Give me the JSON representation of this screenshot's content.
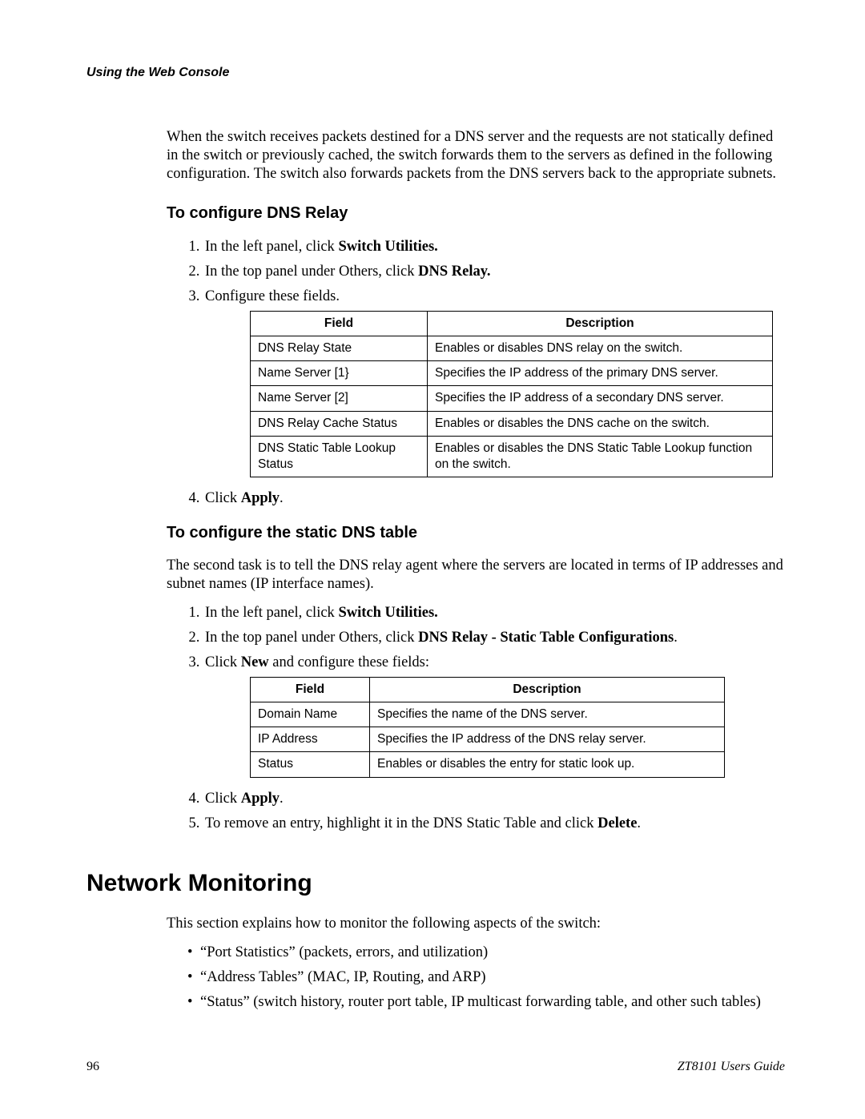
{
  "header": "Using the Web Console",
  "intro_para": "When the switch receives packets destined for a DNS server and the requests are not statically defined in the switch or previously cached, the switch forwards them to the servers as defined in the following configuration. The switch also forwards packets from the DNS servers back to the appropriate subnets.",
  "section1": {
    "heading": "To configure DNS Relay",
    "steps": [
      {
        "pre": "In the left panel, click ",
        "bold": "Switch Utilities.",
        "post": ""
      },
      {
        "pre": "In the top panel under Others, click ",
        "bold": "DNS Relay.",
        "post": ""
      },
      {
        "pre": "Configure these fields.",
        "bold": "",
        "post": ""
      }
    ],
    "table": {
      "headers": [
        "Field",
        "Description"
      ],
      "rows": [
        [
          "DNS Relay State",
          "Enables or disables DNS relay on the switch."
        ],
        [
          "Name Server [1}",
          "Specifies the IP address of the primary DNS server."
        ],
        [
          "Name Server [2]",
          "Specifies the IP address of a secondary DNS server."
        ],
        [
          "DNS Relay Cache Status",
          "Enables or disables the DNS cache on the switch."
        ],
        [
          "DNS Static Table Lookup Status",
          "Enables or disables the DNS Static Table Lookup function on the switch."
        ]
      ]
    },
    "step4": {
      "pre": "Click ",
      "bold": "Apply",
      "post": "."
    }
  },
  "section2": {
    "heading": "To configure the static DNS table",
    "para": "The second task is to tell the DNS relay agent where the servers are located in terms of IP addresses and subnet names (IP interface names).",
    "steps": [
      {
        "pre": "In the left panel, click ",
        "bold": "Switch Utilities.",
        "post": ""
      },
      {
        "pre": "In the top panel under Others, click ",
        "bold": "DNS Relay - Static Table Configurations",
        "post": "."
      },
      {
        "pre": "Click ",
        "bold": "New",
        "post": " and configure these fields:"
      }
    ],
    "table": {
      "headers": [
        "Field",
        "Description"
      ],
      "rows": [
        [
          "Domain Name",
          "Specifies the name of the DNS server."
        ],
        [
          "IP Address",
          "Specifies the IP address of the DNS relay server."
        ],
        [
          "Status",
          "Enables or disables the entry for static look up."
        ]
      ]
    },
    "step4": {
      "pre": "Click ",
      "bold": "Apply",
      "post": "."
    },
    "step5": {
      "pre": "To remove an entry, highlight it in the DNS Static Table and click ",
      "bold": "Delete",
      "post": "."
    }
  },
  "section3": {
    "heading": "Network Monitoring",
    "para": "This section explains how to monitor the following aspects of the switch:",
    "bullets": [
      "“Port Statistics” (packets, errors, and utilization)",
      "“Address Tables” (MAC, IP, Routing, and ARP)",
      "“Status” (switch history, router port table, IP multicast forwarding table, and other such tables)"
    ]
  },
  "footer": {
    "page": "96",
    "guide": "ZT8101 Users Guide"
  }
}
